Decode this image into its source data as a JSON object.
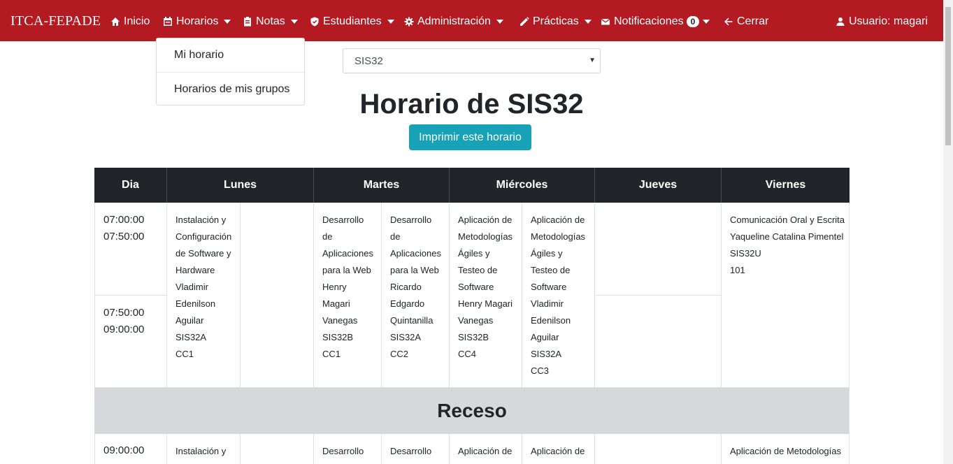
{
  "navbar": {
    "brand": "ITCA-FEPADE",
    "items": [
      {
        "label": "Inicio",
        "icon": "home-icon"
      },
      {
        "label": "Horarios",
        "icon": "calendar-icon"
      },
      {
        "label": "Notas",
        "icon": "clipboard-icon"
      },
      {
        "label": "Estudiantes",
        "icon": "shield-icon"
      },
      {
        "label": "Administración",
        "icon": "gear-icon"
      },
      {
        "label": "Prácticas",
        "icon": "pencil-icon"
      },
      {
        "label": "Notificaciones",
        "icon": "envelope-icon",
        "badge": "0"
      },
      {
        "label": "Cerrar",
        "icon": "arrow-left-icon"
      }
    ],
    "user": {
      "label": "Usuario: magari",
      "icon": "user-icon"
    },
    "color": "#b31a22"
  },
  "dropdown": {
    "items": [
      {
        "label": "Mi horario"
      },
      {
        "label": "Horarios de mis grupos"
      }
    ]
  },
  "group_select": {
    "value": "SIS32"
  },
  "page": {
    "title": "Horario de SIS32",
    "print_button": "Imprimir este horario",
    "button_color": "#17a2b8"
  },
  "schedule": {
    "headers": [
      "Dia",
      "Lunes",
      "Martes",
      "Miércoles",
      "Jueves",
      "Viernes"
    ],
    "block1": {
      "time1": [
        "07:00:00",
        "07:50:00"
      ],
      "time2": [
        "07:50:00",
        "09:00:00"
      ],
      "lunes_a": [
        "Instalación y",
        "Configuración",
        "de Software y",
        "Hardware",
        "Vladimir",
        "Edenilson",
        "Aguilar",
        "SIS32A",
        "CC1"
      ],
      "martes_a": [
        "Desarrollo",
        "de",
        "Aplicaciones",
        "para la Web",
        "Henry",
        "Magari",
        "Vanegas",
        "SIS32B",
        "CC1"
      ],
      "martes_b": [
        "Desarrollo",
        "de",
        "Aplicaciones",
        "para la Web",
        "Ricardo",
        "Edgardo",
        "Quintanilla",
        "SIS32A",
        "CC2"
      ],
      "miercoles_a": [
        "Aplicación de",
        "Metodologías",
        "Ágiles y",
        "Testeo de",
        "Software",
        "Henry Magari",
        "Vanegas",
        "SIS32B",
        "CC4"
      ],
      "miercoles_b": [
        "Aplicación de",
        "Metodologías",
        "Ágiles y",
        "Testeo de",
        "Software",
        "Vladimir",
        "Edenilson",
        "Aguilar",
        "SIS32A",
        "CC3"
      ],
      "viernes": [
        "Comunicación Oral y Escrita",
        "Yaqueline Catalina Pimentel",
        "SIS32U",
        "101"
      ]
    },
    "recess": "Receso",
    "block2": {
      "time1": "09:00:00",
      "lunes_a": "Instalación y",
      "martes_a": "Desarrollo",
      "martes_b": "Desarrollo",
      "miercoles_a": "Aplicación de",
      "miercoles_b": "Aplicación de",
      "viernes": "Aplicación de Metodologías"
    }
  }
}
